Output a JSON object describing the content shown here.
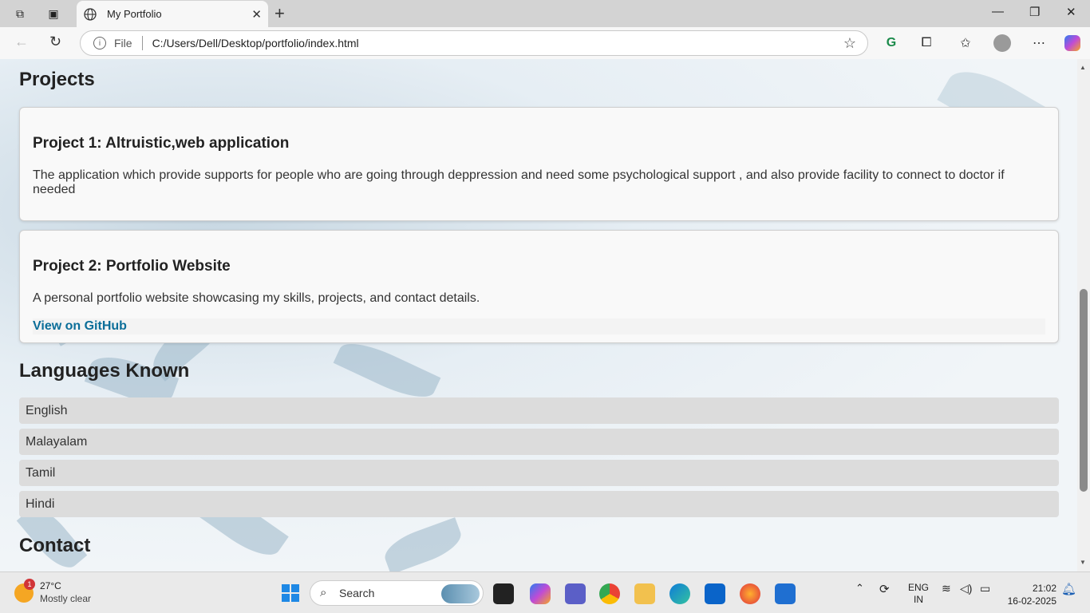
{
  "browser": {
    "tab_title": "My Portfolio",
    "address_scheme": "File",
    "address_url": "C:/Users/Dell/Desktop/portfolio/index.html"
  },
  "page": {
    "projects_heading": "Projects",
    "projects": [
      {
        "title": "Project 1: Altruistic,web application",
        "description": "The application which provide supports for people who are going through deppression and need some psychological support , and also provide facility to connect to doctor if needed"
      },
      {
        "title": "Project 2: Portfolio Website",
        "description": "A personal portfolio website showcasing my skills, projects, and contact details.",
        "link": "View on GitHub"
      }
    ],
    "languages_heading": "Languages Known",
    "languages": [
      "English",
      "Malayalam",
      "Tamil",
      "Hindi"
    ],
    "contact_heading": "Contact"
  },
  "taskbar": {
    "weather_badge": "1",
    "temperature": "27°C",
    "condition": "Mostly clear",
    "search_label": "Search",
    "lang_line1": "ENG",
    "lang_line2": "IN",
    "time": "21:02",
    "date": "16-02-2025"
  },
  "colors": {
    "link": "#0b6e99",
    "card_bg": "#f9f9f9",
    "language_row_bg": "#dcdcdc"
  }
}
